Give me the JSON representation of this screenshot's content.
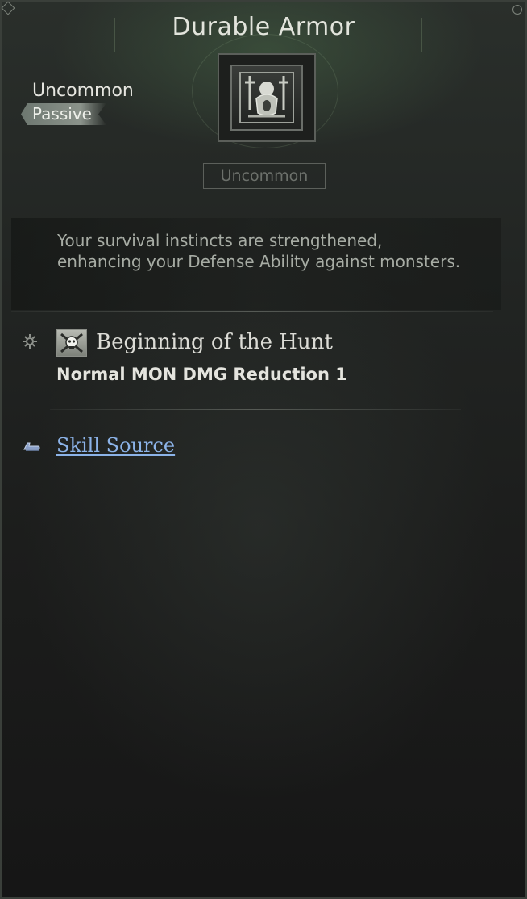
{
  "header": {
    "title": "Durable Armor",
    "rarity_label": "Uncommon",
    "type_tag": "Passive",
    "rarity_badge": "Uncommon",
    "skill_icon": "armor-crest-icon"
  },
  "description": {
    "text": "Your survival instincts are strengthened, enhancing your Defense Ability against monsters."
  },
  "effect": {
    "bullet_icon": "gear-icon",
    "icon": "skull-swords-icon",
    "name": "Beginning of the Hunt",
    "detail": "Normal MON DMG Reduction 1"
  },
  "source": {
    "icon": "pointing-hand-icon",
    "link_label": "Skill Source"
  },
  "colors": {
    "link": "#8cb3e8",
    "badge_text": "#6c706b",
    "description_text": "#a7aca4",
    "header_glow": "#46644b"
  }
}
